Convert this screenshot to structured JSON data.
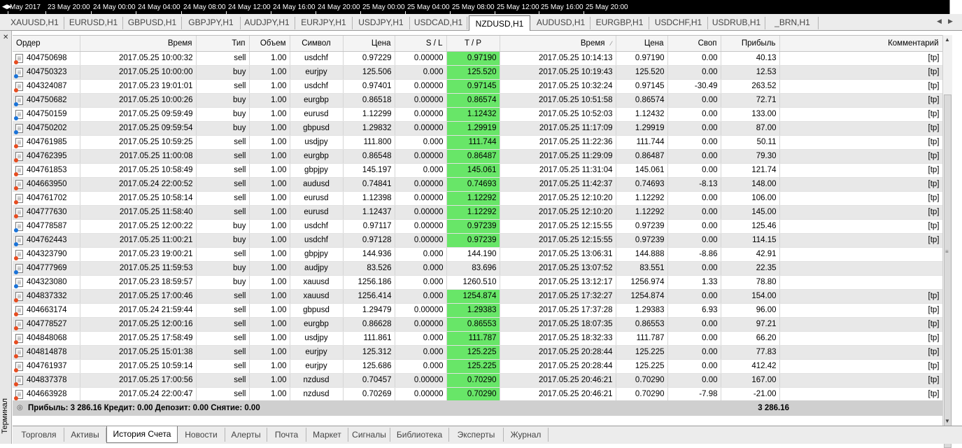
{
  "timescale": {
    "labels": [
      "May 2017",
      "23 May 20:00",
      "24 May 00:00",
      "24 May 04:00",
      "24 May 08:00",
      "24 May 12:00",
      "24 May 16:00",
      "24 May 20:00",
      "25 May 00:00",
      "25 May 04:00",
      "25 May 08:00",
      "25 May 12:00",
      "25 May 16:00",
      "25 May 20:00"
    ]
  },
  "chart_tabs": [
    {
      "label": "XAUUSD,H1",
      "active": false
    },
    {
      "label": "EURUSD,H1",
      "active": false
    },
    {
      "label": "GBPUSD,H1",
      "active": false
    },
    {
      "label": "GBPJPY,H1",
      "active": false
    },
    {
      "label": "AUDJPY,H1",
      "active": false
    },
    {
      "label": "EURJPY,H1",
      "active": false
    },
    {
      "label": "USDJPY,H1",
      "active": false
    },
    {
      "label": "USDCAD,H1",
      "active": false
    },
    {
      "label": "NZDUSD,H1",
      "active": true
    },
    {
      "label": "AUDUSD,H1",
      "active": false
    },
    {
      "label": "EURGBP,H1",
      "active": false
    },
    {
      "label": "USDCHF,H1",
      "active": false
    },
    {
      "label": "USDRUB,H1",
      "active": false
    },
    {
      "label": "_BRN,H1",
      "active": false
    }
  ],
  "terminal_label": "Терминал",
  "columns": [
    "Ордер",
    "Время",
    "Тип",
    "Объем",
    "Символ",
    "Цена",
    "S / L",
    "T / P",
    "Время",
    "Цена",
    "Своп",
    "Прибыль",
    "Комментарий"
  ],
  "rows": [
    {
      "order": "404750698",
      "open_time": "2017.05.25 10:00:32",
      "type": "sell",
      "volume": "1.00",
      "symbol": "usdchf",
      "open_price": "0.97229",
      "sl": "0.00000",
      "tp": "0.97190",
      "tp_hit": true,
      "close_time": "2017.05.25 10:14:13",
      "close_price": "0.97190",
      "swap": "0.00",
      "profit": "40.13",
      "comment": "[tp]"
    },
    {
      "order": "404750323",
      "open_time": "2017.05.25 10:00:00",
      "type": "buy",
      "volume": "1.00",
      "symbol": "eurjpy",
      "open_price": "125.506",
      "sl": "0.000",
      "tp": "125.520",
      "tp_hit": true,
      "close_time": "2017.05.25 10:19:43",
      "close_price": "125.520",
      "swap": "0.00",
      "profit": "12.53",
      "comment": "[tp]"
    },
    {
      "order": "404324087",
      "open_time": "2017.05.23 19:01:01",
      "type": "sell",
      "volume": "1.00",
      "symbol": "usdchf",
      "open_price": "0.97401",
      "sl": "0.00000",
      "tp": "0.97145",
      "tp_hit": true,
      "close_time": "2017.05.25 10:32:24",
      "close_price": "0.97145",
      "swap": "-30.49",
      "profit": "263.52",
      "comment": "[tp]"
    },
    {
      "order": "404750682",
      "open_time": "2017.05.25 10:00:26",
      "type": "buy",
      "volume": "1.00",
      "symbol": "eurgbp",
      "open_price": "0.86518",
      "sl": "0.00000",
      "tp": "0.86574",
      "tp_hit": true,
      "close_time": "2017.05.25 10:51:58",
      "close_price": "0.86574",
      "swap": "0.00",
      "profit": "72.71",
      "comment": "[tp]"
    },
    {
      "order": "404750159",
      "open_time": "2017.05.25 09:59:49",
      "type": "buy",
      "volume": "1.00",
      "symbol": "eurusd",
      "open_price": "1.12299",
      "sl": "0.00000",
      "tp": "1.12432",
      "tp_hit": true,
      "close_time": "2017.05.25 10:52:03",
      "close_price": "1.12432",
      "swap": "0.00",
      "profit": "133.00",
      "comment": "[tp]"
    },
    {
      "order": "404750202",
      "open_time": "2017.05.25 09:59:54",
      "type": "buy",
      "volume": "1.00",
      "symbol": "gbpusd",
      "open_price": "1.29832",
      "sl": "0.00000",
      "tp": "1.29919",
      "tp_hit": true,
      "close_time": "2017.05.25 11:17:09",
      "close_price": "1.29919",
      "swap": "0.00",
      "profit": "87.00",
      "comment": "[tp]"
    },
    {
      "order": "404761985",
      "open_time": "2017.05.25 10:59:25",
      "type": "sell",
      "volume": "1.00",
      "symbol": "usdjpy",
      "open_price": "111.800",
      "sl": "0.000",
      "tp": "111.744",
      "tp_hit": true,
      "close_time": "2017.05.25 11:22:36",
      "close_price": "111.744",
      "swap": "0.00",
      "profit": "50.11",
      "comment": "[tp]"
    },
    {
      "order": "404762395",
      "open_time": "2017.05.25 11:00:08",
      "type": "sell",
      "volume": "1.00",
      "symbol": "eurgbp",
      "open_price": "0.86548",
      "sl": "0.00000",
      "tp": "0.86487",
      "tp_hit": true,
      "close_time": "2017.05.25 11:29:09",
      "close_price": "0.86487",
      "swap": "0.00",
      "profit": "79.30",
      "comment": "[tp]"
    },
    {
      "order": "404761853",
      "open_time": "2017.05.25 10:58:49",
      "type": "sell",
      "volume": "1.00",
      "symbol": "gbpjpy",
      "open_price": "145.197",
      "sl": "0.000",
      "tp": "145.061",
      "tp_hit": true,
      "close_time": "2017.05.25 11:31:04",
      "close_price": "145.061",
      "swap": "0.00",
      "profit": "121.74",
      "comment": "[tp]"
    },
    {
      "order": "404663950",
      "open_time": "2017.05.24 22:00:52",
      "type": "sell",
      "volume": "1.00",
      "symbol": "audusd",
      "open_price": "0.74841",
      "sl": "0.00000",
      "tp": "0.74693",
      "tp_hit": true,
      "close_time": "2017.05.25 11:42:37",
      "close_price": "0.74693",
      "swap": "-8.13",
      "profit": "148.00",
      "comment": "[tp]"
    },
    {
      "order": "404761702",
      "open_time": "2017.05.25 10:58:14",
      "type": "sell",
      "volume": "1.00",
      "symbol": "eurusd",
      "open_price": "1.12398",
      "sl": "0.00000",
      "tp": "1.12292",
      "tp_hit": true,
      "close_time": "2017.05.25 12:10:20",
      "close_price": "1.12292",
      "swap": "0.00",
      "profit": "106.00",
      "comment": "[tp]"
    },
    {
      "order": "404777630",
      "open_time": "2017.05.25 11:58:40",
      "type": "sell",
      "volume": "1.00",
      "symbol": "eurusd",
      "open_price": "1.12437",
      "sl": "0.00000",
      "tp": "1.12292",
      "tp_hit": true,
      "close_time": "2017.05.25 12:10:20",
      "close_price": "1.12292",
      "swap": "0.00",
      "profit": "145.00",
      "comment": "[tp]"
    },
    {
      "order": "404778587",
      "open_time": "2017.05.25 12:00:22",
      "type": "buy",
      "volume": "1.00",
      "symbol": "usdchf",
      "open_price": "0.97117",
      "sl": "0.00000",
      "tp": "0.97239",
      "tp_hit": true,
      "close_time": "2017.05.25 12:15:55",
      "close_price": "0.97239",
      "swap": "0.00",
      "profit": "125.46",
      "comment": "[tp]"
    },
    {
      "order": "404762443",
      "open_time": "2017.05.25 11:00:21",
      "type": "buy",
      "volume": "1.00",
      "symbol": "usdchf",
      "open_price": "0.97128",
      "sl": "0.00000",
      "tp": "0.97239",
      "tp_hit": true,
      "close_time": "2017.05.25 12:15:55",
      "close_price": "0.97239",
      "swap": "0.00",
      "profit": "114.15",
      "comment": "[tp]"
    },
    {
      "order": "404323790",
      "open_time": "2017.05.23 19:00:21",
      "type": "sell",
      "volume": "1.00",
      "symbol": "gbpjpy",
      "open_price": "144.936",
      "sl": "0.000",
      "tp": "144.190",
      "tp_hit": false,
      "close_time": "2017.05.25 13:06:31",
      "close_price": "144.888",
      "swap": "-8.86",
      "profit": "42.91",
      "comment": ""
    },
    {
      "order": "404777969",
      "open_time": "2017.05.25 11:59:53",
      "type": "buy",
      "volume": "1.00",
      "symbol": "audjpy",
      "open_price": "83.526",
      "sl": "0.000",
      "tp": "83.696",
      "tp_hit": false,
      "close_time": "2017.05.25 13:07:52",
      "close_price": "83.551",
      "swap": "0.00",
      "profit": "22.35",
      "comment": ""
    },
    {
      "order": "404323080",
      "open_time": "2017.05.23 18:59:57",
      "type": "buy",
      "volume": "1.00",
      "symbol": "xauusd",
      "open_price": "1256.186",
      "sl": "0.000",
      "tp": "1260.510",
      "tp_hit": false,
      "close_time": "2017.05.25 13:12:17",
      "close_price": "1256.974",
      "swap": "1.33",
      "profit": "78.80",
      "comment": ""
    },
    {
      "order": "404837332",
      "open_time": "2017.05.25 17:00:46",
      "type": "sell",
      "volume": "1.00",
      "symbol": "xauusd",
      "open_price": "1256.414",
      "sl": "0.000",
      "tp": "1254.874",
      "tp_hit": true,
      "close_time": "2017.05.25 17:32:27",
      "close_price": "1254.874",
      "swap": "0.00",
      "profit": "154.00",
      "comment": "[tp]"
    },
    {
      "order": "404663174",
      "open_time": "2017.05.24 21:59:44",
      "type": "sell",
      "volume": "1.00",
      "symbol": "gbpusd",
      "open_price": "1.29479",
      "sl": "0.00000",
      "tp": "1.29383",
      "tp_hit": true,
      "close_time": "2017.05.25 17:37:28",
      "close_price": "1.29383",
      "swap": "6.93",
      "profit": "96.00",
      "comment": "[tp]"
    },
    {
      "order": "404778527",
      "open_time": "2017.05.25 12:00:16",
      "type": "sell",
      "volume": "1.00",
      "symbol": "eurgbp",
      "open_price": "0.86628",
      "sl": "0.00000",
      "tp": "0.86553",
      "tp_hit": true,
      "close_time": "2017.05.25 18:07:35",
      "close_price": "0.86553",
      "swap": "0.00",
      "profit": "97.21",
      "comment": "[tp]"
    },
    {
      "order": "404848068",
      "open_time": "2017.05.25 17:58:49",
      "type": "sell",
      "volume": "1.00",
      "symbol": "usdjpy",
      "open_price": "111.861",
      "sl": "0.000",
      "tp": "111.787",
      "tp_hit": true,
      "close_time": "2017.05.25 18:32:33",
      "close_price": "111.787",
      "swap": "0.00",
      "profit": "66.20",
      "comment": "[tp]"
    },
    {
      "order": "404814878",
      "open_time": "2017.05.25 15:01:38",
      "type": "sell",
      "volume": "1.00",
      "symbol": "eurjpy",
      "open_price": "125.312",
      "sl": "0.000",
      "tp": "125.225",
      "tp_hit": true,
      "close_time": "2017.05.25 20:28:44",
      "close_price": "125.225",
      "swap": "0.00",
      "profit": "77.83",
      "comment": "[tp]"
    },
    {
      "order": "404761937",
      "open_time": "2017.05.25 10:59:14",
      "type": "sell",
      "volume": "1.00",
      "symbol": "eurjpy",
      "open_price": "125.686",
      "sl": "0.000",
      "tp": "125.225",
      "tp_hit": true,
      "close_time": "2017.05.25 20:28:44",
      "close_price": "125.225",
      "swap": "0.00",
      "profit": "412.42",
      "comment": "[tp]"
    },
    {
      "order": "404837378",
      "open_time": "2017.05.25 17:00:56",
      "type": "sell",
      "volume": "1.00",
      "symbol": "nzdusd",
      "open_price": "0.70457",
      "sl": "0.00000",
      "tp": "0.70290",
      "tp_hit": true,
      "close_time": "2017.05.25 20:46:21",
      "close_price": "0.70290",
      "swap": "0.00",
      "profit": "167.00",
      "comment": "[tp]"
    },
    {
      "order": "404663928",
      "open_time": "2017.05.24 22:00:47",
      "type": "sell",
      "volume": "1.00",
      "symbol": "nzdusd",
      "open_price": "0.70269",
      "sl": "0.00000",
      "tp": "0.70290",
      "tp_hit": true,
      "close_time": "2017.05.25 20:46:21",
      "close_price": "0.70290",
      "swap": "-7.98",
      "profit": "-21.00",
      "comment": "[tp]"
    }
  ],
  "summary": {
    "text": "Прибыль: 3 286.16  Кредит: 0.00  Депозит: 0.00  Снятие: 0.00",
    "total_profit": "3 286.16"
  },
  "bottom_tabs": [
    {
      "label": "Торговля",
      "active": false
    },
    {
      "label": "Активы",
      "active": false
    },
    {
      "label": "История Счета",
      "active": true
    },
    {
      "label": "Новости",
      "active": false
    },
    {
      "label": "Алерты",
      "active": false
    },
    {
      "label": "Почта",
      "active": false
    },
    {
      "label": "Маркет",
      "active": false
    },
    {
      "label": "Сигналы",
      "active": false
    },
    {
      "label": "Библиотека",
      "active": false
    },
    {
      "label": "Эксперты",
      "active": false
    },
    {
      "label": "Журнал",
      "active": false
    }
  ],
  "colors": {
    "tp_hit": "#68e668",
    "sell_dot": "#e64c20",
    "buy_dot": "#1a73d8",
    "alt_row": "#e8e8e8"
  }
}
